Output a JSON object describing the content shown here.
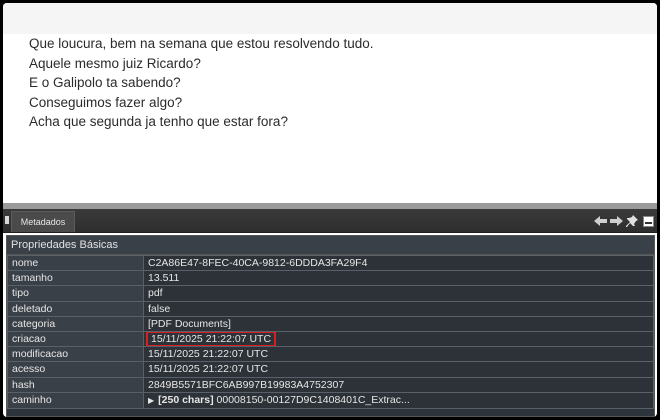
{
  "document": {
    "lines": [
      "Que loucura, bem na semana que estou resolvendo tudo.",
      "Aquele mesmo juiz Ricardo?",
      "E o Galipolo ta sabendo?",
      "Conseguimos fazer algo?",
      "Acha que segunda ja tenho que estar fora?"
    ]
  },
  "tabbar": {
    "tab_label": "Metadados",
    "icons": [
      "arrow-left-icon",
      "arrow-right-icon",
      "pin-icon",
      "minimize-icon"
    ]
  },
  "properties": {
    "title": "Propriedades Básicas",
    "rows": [
      {
        "key": "nome",
        "value": "C2A86E47-8FEC-40CA-9812-6DDDA3FA29F4"
      },
      {
        "key": "tamanho",
        "value": "13.511"
      },
      {
        "key": "tipo",
        "value": "pdf"
      },
      {
        "key": "deletado",
        "value": "false"
      },
      {
        "key": "categoria",
        "value": "[PDF Documents]"
      },
      {
        "key": "criacao",
        "value": "15/11/2025 21:22:07 UTC",
        "highlighted": true
      },
      {
        "key": "modificacao",
        "value": "15/11/2025 21:22:07 UTC"
      },
      {
        "key": "acesso",
        "value": "15/11/2025 21:22:07 UTC"
      },
      {
        "key": "hash",
        "value": "2849B5571BFC6AB997B19983A4752307"
      },
      {
        "key": "caminho",
        "value_bold": "[250 chars]",
        "value": "00008150-00127D9C1408401C_Extrac..."
      }
    ]
  },
  "colors": {
    "highlight": "#d42020",
    "panel_bg": "#2e343b"
  }
}
